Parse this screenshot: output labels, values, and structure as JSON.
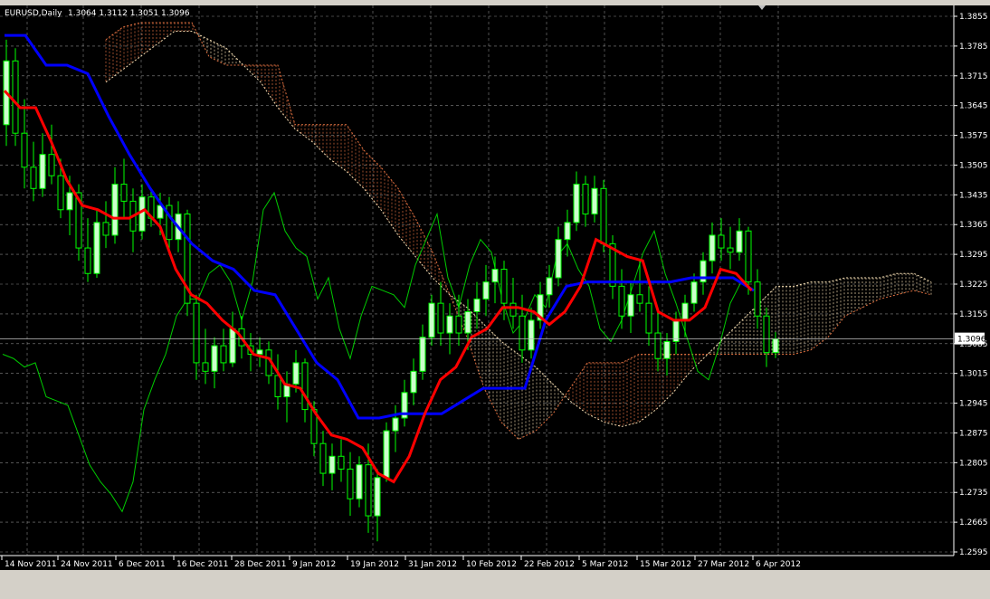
{
  "window": {
    "symbol": "EURUSD,Daily",
    "ohlc": "1.3064 1.3112 1.3051 1.3096"
  },
  "colors": {
    "background": "#000000",
    "grid": "#c0c0c0",
    "axis_text": "#ffffff",
    "bull_candle": "#ccffcc",
    "bear_candle": "#000000",
    "candle_wick": "#00ff00",
    "tenkan": "#ff0000",
    "kijun": "#0000ff",
    "chikou": "#00cc00",
    "cloud_bull": "#f5deb3",
    "cloud_bear": "#e07040",
    "price_line": "#c0c0c0"
  },
  "chart_data": {
    "type": "candlestick",
    "title": "EURUSD,Daily",
    "indicator": "Ichimoku Kinko Hyo",
    "current_price": "1.3096",
    "ylim": [
      1.2595,
      1.3855
    ],
    "y_ticks": [
      "1.3855",
      "1.3785",
      "1.3715",
      "1.3645",
      "1.3575",
      "1.3505",
      "1.3435",
      "1.3365",
      "1.3295",
      "1.3225",
      "1.3155",
      "1.3085",
      "1.3015",
      "1.2945",
      "1.2875",
      "1.2805",
      "1.2735",
      "1.2665",
      "1.2595"
    ],
    "x_ticks": [
      "14 Nov 2011",
      "24 Nov 2011",
      "6 Dec 2011",
      "16 Dec 2011",
      "28 Dec 2011",
      "9 Jan 2012",
      "19 Jan 2012",
      "31 Jan 2012",
      "10 Feb 2012",
      "22 Feb 2012",
      "5 Mar 2012",
      "15 Mar 2012",
      "27 Mar 2012",
      "6 Apr 2012"
    ],
    "grid": true,
    "candles": [
      [
        1.36,
        1.38,
        1.355,
        1.375
      ],
      [
        1.375,
        1.378,
        1.355,
        1.358
      ],
      [
        1.358,
        1.366,
        1.345,
        1.35
      ],
      [
        1.35,
        1.356,
        1.342,
        1.345
      ],
      [
        1.345,
        1.358,
        1.343,
        1.353
      ],
      [
        1.353,
        1.36,
        1.346,
        1.348
      ],
      [
        1.348,
        1.352,
        1.338,
        1.34
      ],
      [
        1.34,
        1.348,
        1.334,
        1.344
      ],
      [
        1.344,
        1.346,
        1.328,
        1.331
      ],
      [
        1.331,
        1.338,
        1.323,
        1.325
      ],
      [
        1.325,
        1.34,
        1.324,
        1.337
      ],
      [
        1.337,
        1.342,
        1.331,
        1.334
      ],
      [
        1.334,
        1.35,
        1.332,
        1.346
      ],
      [
        1.346,
        1.352,
        1.338,
        1.342
      ],
      [
        1.342,
        1.345,
        1.33,
        1.335
      ],
      [
        1.335,
        1.346,
        1.333,
        1.343
      ],
      [
        1.343,
        1.345,
        1.336,
        1.338
      ],
      [
        1.338,
        1.344,
        1.334,
        1.341
      ],
      [
        1.341,
        1.343,
        1.33,
        1.333
      ],
      [
        1.333,
        1.342,
        1.33,
        1.339
      ],
      [
        1.339,
        1.34,
        1.315,
        1.318
      ],
      [
        1.318,
        1.32,
        1.3,
        1.304
      ],
      [
        1.304,
        1.312,
        1.299,
        1.302
      ],
      [
        1.302,
        1.31,
        1.298,
        1.308
      ],
      [
        1.308,
        1.312,
        1.302,
        1.304
      ],
      [
        1.304,
        1.316,
        1.303,
        1.312
      ],
      [
        1.312,
        1.315,
        1.305,
        1.308
      ],
      [
        1.308,
        1.311,
        1.302,
        1.306
      ],
      [
        1.306,
        1.31,
        1.303,
        1.307
      ],
      [
        1.307,
        1.309,
        1.299,
        1.301
      ],
      [
        1.301,
        1.306,
        1.293,
        1.296
      ],
      [
        1.296,
        1.302,
        1.29,
        1.299
      ],
      [
        1.299,
        1.307,
        1.297,
        1.304
      ],
      [
        1.304,
        1.305,
        1.29,
        1.293
      ],
      [
        1.293,
        1.295,
        1.282,
        1.285
      ],
      [
        1.285,
        1.288,
        1.275,
        1.278
      ],
      [
        1.278,
        1.285,
        1.274,
        1.282
      ],
      [
        1.282,
        1.286,
        1.276,
        1.279
      ],
      [
        1.279,
        1.283,
        1.268,
        1.272
      ],
      [
        1.272,
        1.282,
        1.27,
        1.28
      ],
      [
        1.28,
        1.285,
        1.264,
        1.268
      ],
      [
        1.268,
        1.279,
        1.262,
        1.277
      ],
      [
        1.277,
        1.29,
        1.276,
        1.288
      ],
      [
        1.288,
        1.294,
        1.283,
        1.291
      ],
      [
        1.291,
        1.3,
        1.289,
        1.297
      ],
      [
        1.297,
        1.305,
        1.294,
        1.302
      ],
      [
        1.302,
        1.313,
        1.3,
        1.31
      ],
      [
        1.31,
        1.32,
        1.308,
        1.318
      ],
      [
        1.318,
        1.323,
        1.308,
        1.311
      ],
      [
        1.311,
        1.318,
        1.306,
        1.315
      ],
      [
        1.315,
        1.32,
        1.308,
        1.311
      ],
      [
        1.311,
        1.319,
        1.307,
        1.316
      ],
      [
        1.316,
        1.323,
        1.312,
        1.319
      ],
      [
        1.319,
        1.327,
        1.315,
        1.323
      ],
      [
        1.323,
        1.329,
        1.318,
        1.326
      ],
      [
        1.326,
        1.328,
        1.314,
        1.318
      ],
      [
        1.318,
        1.324,
        1.312,
        1.315
      ],
      [
        1.315,
        1.32,
        1.304,
        1.307
      ],
      [
        1.307,
        1.317,
        1.305,
        1.314
      ],
      [
        1.314,
        1.323,
        1.312,
        1.32
      ],
      [
        1.32,
        1.327,
        1.317,
        1.324
      ],
      [
        1.324,
        1.336,
        1.322,
        1.333
      ],
      [
        1.333,
        1.34,
        1.329,
        1.337
      ],
      [
        1.337,
        1.349,
        1.335,
        1.346
      ],
      [
        1.346,
        1.348,
        1.336,
        1.339
      ],
      [
        1.339,
        1.348,
        1.337,
        1.345
      ],
      [
        1.345,
        1.347,
        1.33,
        1.332
      ],
      [
        1.332,
        1.334,
        1.319,
        1.322
      ],
      [
        1.322,
        1.326,
        1.312,
        1.315
      ],
      [
        1.315,
        1.323,
        1.311,
        1.32
      ],
      [
        1.32,
        1.328,
        1.316,
        1.318
      ],
      [
        1.318,
        1.322,
        1.308,
        1.311
      ],
      [
        1.311,
        1.317,
        1.302,
        1.305
      ],
      [
        1.305,
        1.311,
        1.301,
        1.309
      ],
      [
        1.309,
        1.316,
        1.306,
        1.314
      ],
      [
        1.314,
        1.32,
        1.31,
        1.318
      ],
      [
        1.318,
        1.325,
        1.316,
        1.323
      ],
      [
        1.323,
        1.33,
        1.32,
        1.328
      ],
      [
        1.328,
        1.337,
        1.325,
        1.334
      ],
      [
        1.334,
        1.338,
        1.328,
        1.331
      ],
      [
        1.331,
        1.336,
        1.326,
        1.33
      ],
      [
        1.33,
        1.338,
        1.328,
        1.335
      ],
      [
        1.335,
        1.336,
        1.32,
        1.323
      ],
      [
        1.323,
        1.326,
        1.312,
        1.315
      ],
      [
        1.315,
        1.317,
        1.303,
        1.3064
      ],
      [
        1.3064,
        1.3112,
        1.3051,
        1.3096
      ]
    ],
    "tenkan_sen": [
      1.368,
      1.364,
      1.364,
      1.356,
      1.347,
      1.341,
      1.34,
      1.338,
      1.338,
      1.34,
      1.336,
      1.326,
      1.32,
      1.318,
      1.314,
      1.311,
      1.306,
      1.305,
      1.299,
      1.298,
      1.292,
      1.287,
      1.286,
      1.284,
      1.278,
      1.276,
      1.282,
      1.292,
      1.3,
      1.303,
      1.31,
      1.312,
      1.317,
      1.317,
      1.316,
      1.313,
      1.316,
      1.322,
      1.333,
      1.331,
      1.329,
      1.328,
      1.316,
      1.314,
      1.314,
      1.317,
      1.326,
      1.325,
      1.321
    ],
    "kijun_sen": [
      1.381,
      1.381,
      1.374,
      1.374,
      1.372,
      1.362,
      1.353,
      1.345,
      1.338,
      1.332,
      1.328,
      1.326,
      1.321,
      1.32,
      1.312,
      1.304,
      1.3,
      1.291,
      1.291,
      1.292,
      1.292,
      1.292,
      1.295,
      1.298,
      1.298,
      1.298,
      1.314,
      1.322,
      1.323,
      1.323,
      1.323,
      1.323,
      1.323,
      1.324,
      1.324,
      1.324,
      1.321
    ],
    "chikou_span": [
      1.306,
      1.305,
      1.303,
      1.304,
      1.296,
      1.295,
      1.294,
      1.287,
      1.28,
      1.276,
      1.273,
      1.269,
      1.276,
      1.293,
      1.3,
      1.306,
      1.315,
      1.319,
      1.319,
      1.325,
      1.327,
      1.323,
      1.314,
      1.323,
      1.34,
      1.344,
      1.335,
      1.331,
      1.329,
      1.319,
      1.324,
      1.312,
      1.305,
      1.315,
      1.322,
      1.321,
      1.32,
      1.317,
      1.327,
      1.333,
      1.339,
      1.324,
      1.317,
      1.327,
      1.333,
      1.33,
      1.319,
      1.311,
      1.314,
      1.32,
      1.317,
      1.329,
      1.332,
      1.326,
      1.322,
      1.312,
      1.309,
      1.314,
      1.322,
      1.33,
      1.335,
      1.325,
      1.318,
      1.31,
      1.302,
      1.3,
      1.308,
      1.318,
      1.323
    ],
    "senkou_a": [
      1.37,
      1.373,
      1.376,
      1.379,
      1.382,
      1.382,
      1.38,
      1.378,
      1.374,
      1.37,
      1.364,
      1.359,
      1.356,
      1.352,
      1.349,
      1.345,
      1.34,
      1.334,
      1.329,
      1.324,
      1.32,
      1.317,
      1.313,
      1.309,
      1.306,
      1.303,
      1.299,
      1.295,
      1.292,
      1.29,
      1.289,
      1.29,
      1.293,
      1.297,
      1.302,
      1.306,
      1.31,
      1.314,
      1.318,
      1.322,
      1.322,
      1.323,
      1.323,
      1.324,
      1.324,
      1.324,
      1.325,
      1.325,
      1.323
    ],
    "senkou_b": [
      1.38,
      1.383,
      1.384,
      1.384,
      1.384,
      1.384,
      1.376,
      1.374,
      1.374,
      1.374,
      1.374,
      1.36,
      1.36,
      1.36,
      1.36,
      1.354,
      1.35,
      1.345,
      1.338,
      1.33,
      1.32,
      1.31,
      1.298,
      1.29,
      1.286,
      1.288,
      1.292,
      1.298,
      1.304,
      1.304,
      1.304,
      1.306,
      1.306,
      1.306,
      1.306,
      1.306,
      1.306,
      1.306,
      1.306,
      1.306,
      1.306,
      1.307,
      1.31,
      1.315,
      1.317,
      1.319,
      1.32,
      1.321,
      1.32
    ]
  }
}
